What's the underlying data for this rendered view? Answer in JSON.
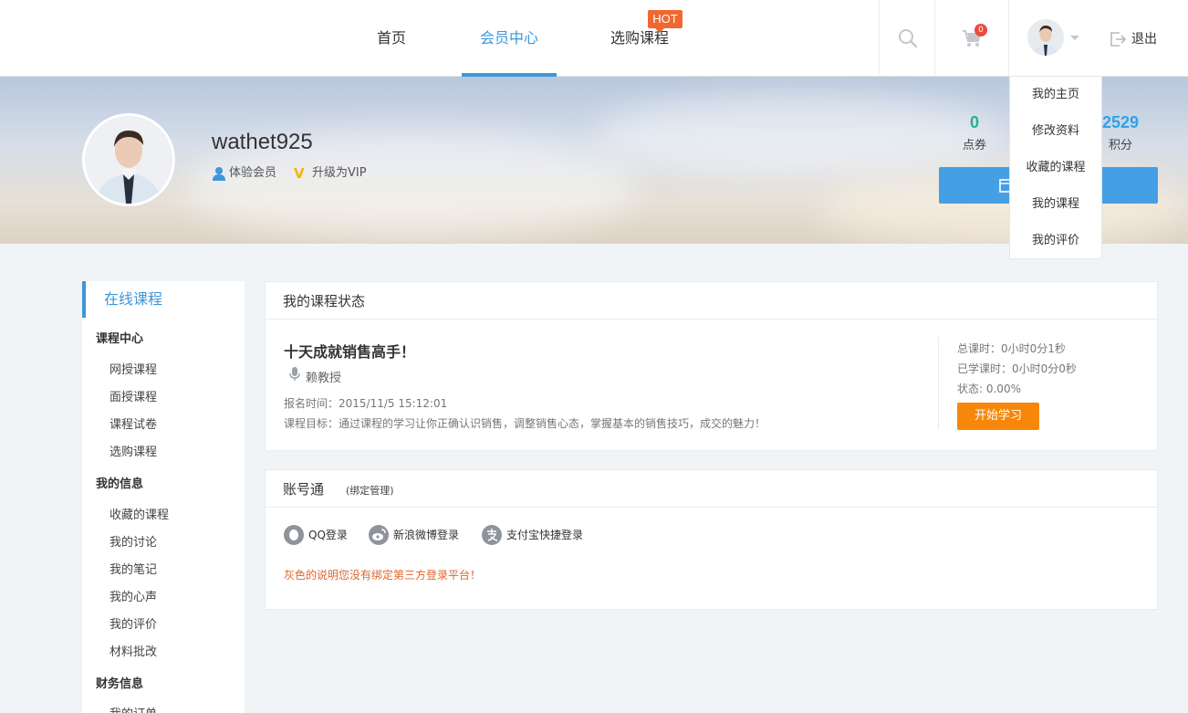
{
  "header": {
    "nav": [
      {
        "label": "首页"
      },
      {
        "label": "会员中心"
      },
      {
        "label": "选购课程"
      }
    ],
    "hot_badge": "HOT",
    "cart_count": "0",
    "logout_label": "退出"
  },
  "dropdown": {
    "items": [
      "我的主页",
      "修改资料",
      "收藏的课程",
      "我的课程",
      "我的评价"
    ]
  },
  "profile": {
    "username": "wathet925",
    "member_type": "体验会员",
    "upgrade_label": "升级为VIP",
    "stats": [
      {
        "value": "0",
        "label": "点券",
        "color": "#1fb489"
      },
      {
        "value": "2529",
        "label": "积分",
        "color": "#2fa3e6"
      }
    ]
  },
  "sidebar": {
    "title": "在线课程",
    "groups": [
      {
        "title": "课程中心",
        "items": [
          "网授课程",
          "面授课程",
          "课程试卷",
          "选购课程"
        ]
      },
      {
        "title": "我的信息",
        "items": [
          "收藏的课程",
          "我的讨论",
          "我的笔记",
          "我的心声",
          "我的评价",
          "材料批改"
        ]
      },
      {
        "title": "财务信息",
        "items": [
          "我的订单"
        ]
      }
    ]
  },
  "course_status": {
    "title": "我的课程状态",
    "course_name": "十天成就销售高手！",
    "teacher": "赖教授",
    "signup_time": "报名时间：2015/11/5 15:12:01",
    "goal": "课程目标：通过课程的学习让你正确认识销售，调整销售心态，掌握基本的销售技巧，成交的魅力！",
    "total_time": "总课时：0小时0分1秒",
    "learned_time": "已学课时：0小时0分0秒",
    "status": "状态: 0.00%",
    "start_button": "开始学习"
  },
  "account": {
    "title": "账号通",
    "subtitle": "(绑定管理)",
    "logins": [
      {
        "label": "QQ登录",
        "icon": "qq-icon"
      },
      {
        "label": "新浪微博登录",
        "icon": "weibo-icon"
      },
      {
        "label": "支付宝快捷登录",
        "icon": "alipay-icon"
      }
    ],
    "notice": "灰色的说明您没有绑定第三方登录平台！"
  }
}
